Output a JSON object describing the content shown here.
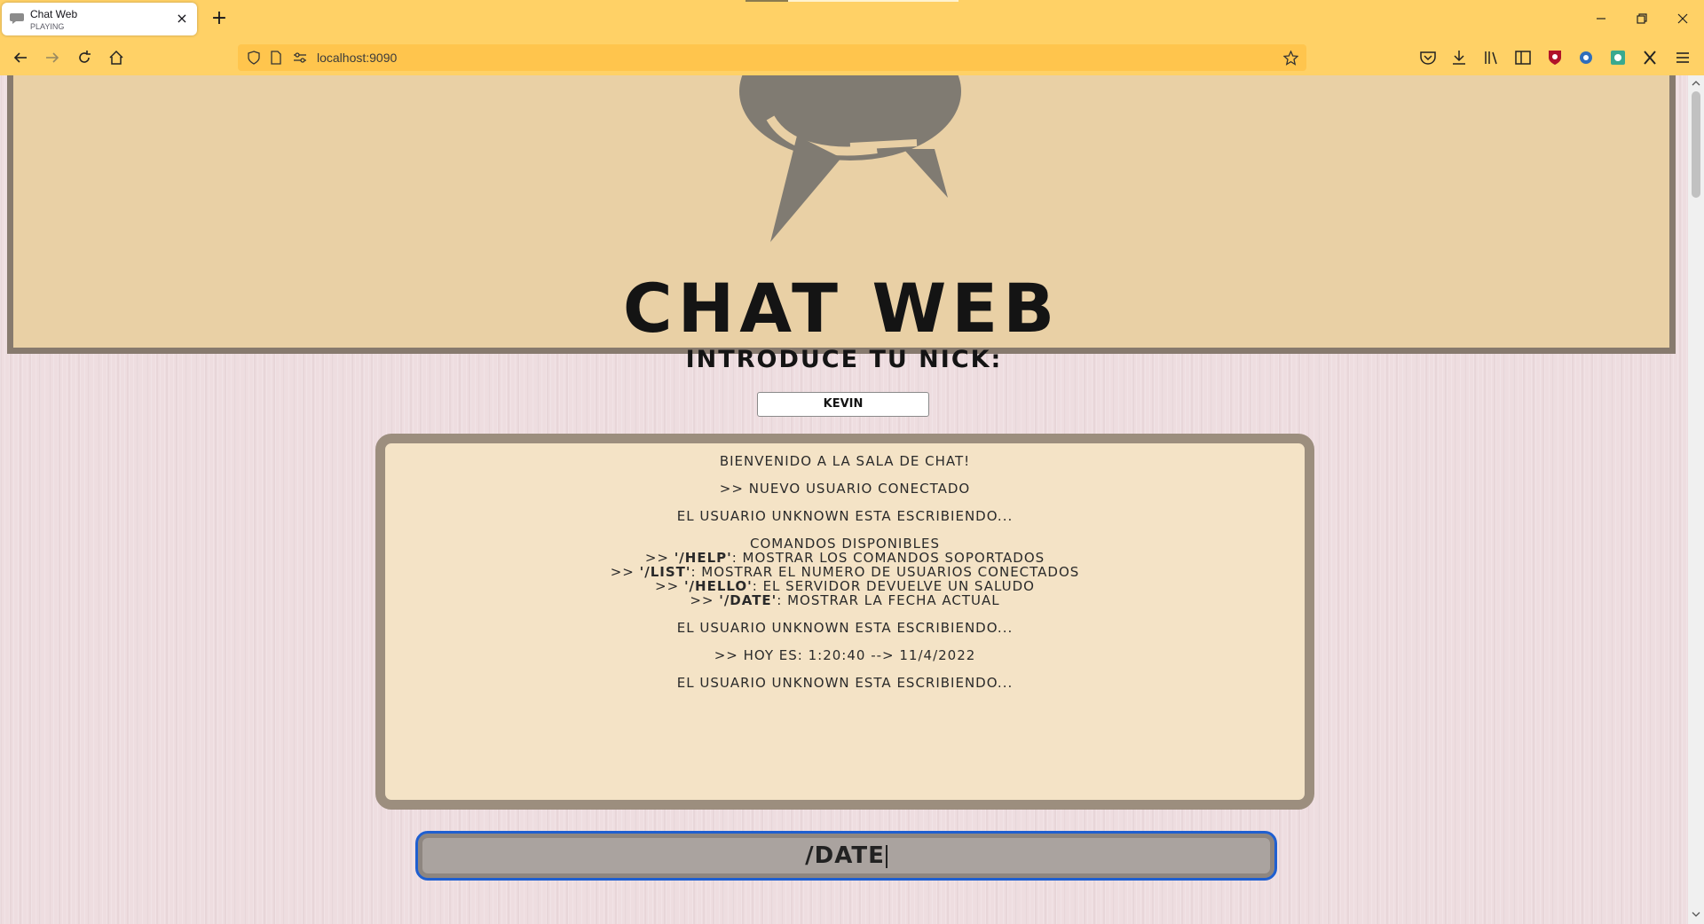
{
  "browser": {
    "tab": {
      "title": "Chat Web",
      "subtitle": "PLAYING",
      "close": "×"
    },
    "new_tab": "+",
    "url": "localhost:9090",
    "icons": [
      "back-icon",
      "forward-icon",
      "reload-icon",
      "home-icon",
      "shield-icon",
      "page-icon",
      "permissions-icon",
      "bookmark-star-icon",
      "pocket-icon",
      "download-icon",
      "library-icon",
      "sidebar-icon",
      "extension-icon",
      "extension-icon",
      "extension-icon",
      "x-icon",
      "menu-icon"
    ],
    "accent": "#ffd166"
  },
  "page": {
    "brand": "CHAT WEB",
    "nick_label": "INTRODUCE TU NICK:",
    "nick_value": "KEVIN",
    "messages": [
      {
        "text": "Bienvenido a la sala de chat!"
      },
      {
        "text": ">> Nuevo usuario conectado"
      },
      {
        "text": "El usuario Unknown esta escribiendo..."
      },
      {
        "lines": [
          "Comandos disponibles",
          {
            "prefix": ">> ",
            "cmd": "'/help'",
            "rest": ": Mostrar los comandos soportados"
          },
          {
            "prefix": ">> ",
            "cmd": "'/list'",
            "rest": ": Mostrar el numero de usuarios conectados"
          },
          {
            "prefix": ">> ",
            "cmd": "'/hello'",
            "rest": ": El servidor devuelve un saludo"
          },
          {
            "prefix": ">> ",
            "cmd": "'/date'",
            "rest": ": Mostrar la fecha actual"
          }
        ]
      },
      {
        "text": "El usuario Unknown esta escribiendo..."
      },
      {
        "text": ">> Hoy es: 1:20:40 --> 11/4/2022"
      },
      {
        "text": "El usuario Unknown esta escribiendo..."
      }
    ],
    "message_input_value": "/DATE",
    "colors": {
      "banner": "#e9d0a5",
      "frame": "#877a6e",
      "chat_bg": "#f4e3c6",
      "focus": "#1f5fd0"
    }
  }
}
